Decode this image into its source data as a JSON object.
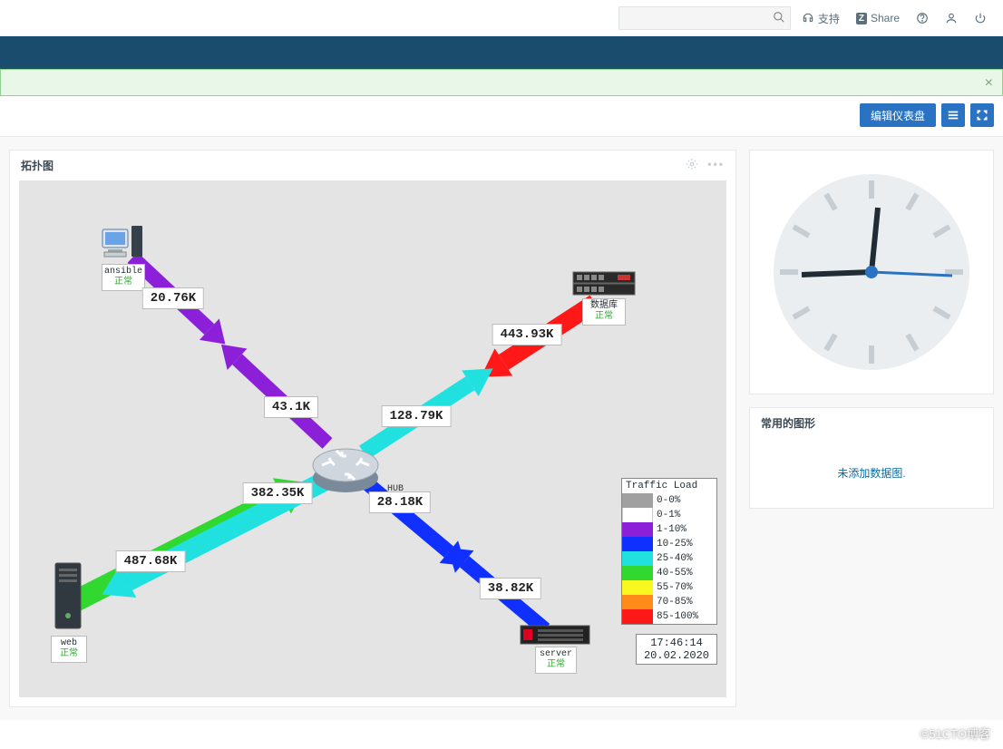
{
  "header": {
    "search_placeholder": "",
    "support": "支持",
    "share": "Share",
    "share_badge": "Z"
  },
  "toolbar": {
    "edit_dashboard": "编辑仪表盘"
  },
  "panels": {
    "topology_title": "拓扑图",
    "graph_title": "常用的图形",
    "graph_empty": "未添加数据图."
  },
  "topology": {
    "nodes": {
      "ansible": {
        "label": "ansible",
        "status": "正常"
      },
      "database": {
        "label": "数据库",
        "status": "正常"
      },
      "web": {
        "label": "web",
        "status": "正常"
      },
      "server": {
        "label": "server",
        "status": "正常"
      },
      "hub": {
        "label": "HUB"
      }
    },
    "links": {
      "ansible_out": "20.76K",
      "ansible_in": "43.1K",
      "db_out": "443.93K",
      "db_in": "128.79K",
      "web_out": "487.68K",
      "web_in": "382.35K",
      "server_out": "38.82K",
      "server_in": "28.18K"
    },
    "legend": {
      "title": "Traffic Load",
      "items": [
        {
          "color": "#a0a0a0",
          "label": "0-0%"
        },
        {
          "color": "#ffffff",
          "label": "0-1%"
        },
        {
          "color": "#8b20d8",
          "label": "1-10%"
        },
        {
          "color": "#1030ff",
          "label": "10-25%"
        },
        {
          "color": "#20e0e0",
          "label": "25-40%"
        },
        {
          "color": "#30d830",
          "label": "40-55%"
        },
        {
          "color": "#f8f820",
          "label": "55-70%"
        },
        {
          "color": "#ff8c1a",
          "label": "70-85%"
        },
        {
          "color": "#ff1818",
          "label": "85-100%"
        }
      ]
    },
    "timestamp": {
      "time": "17:46:14",
      "date": "20.02.2020"
    }
  },
  "watermark": "©51CTO博客"
}
